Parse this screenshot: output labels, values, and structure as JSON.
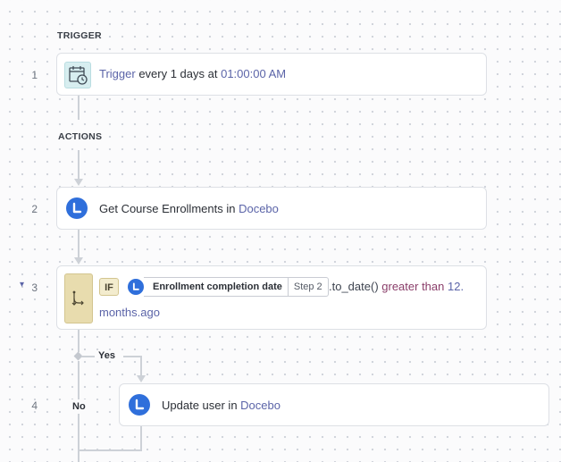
{
  "labels": {
    "trigger_section": "TRIGGER",
    "actions_section": "ACTIONS"
  },
  "steps": {
    "s1": {
      "number": "1",
      "keyword": "Trigger",
      "middle": " every 1 days at ",
      "time": "01:00:00 AM"
    },
    "s2": {
      "number": "2",
      "text": "Get Course Enrollments in ",
      "app": "Docebo"
    },
    "s3": {
      "number": "3",
      "collapse_glyph": "▾",
      "if_label": "IF",
      "pill_text": "Enrollment completion date",
      "pill_step": "Step 2",
      "expr_method": ".to_date()",
      "expr_op": " greater than ",
      "expr_value": "12.",
      "expr_line2": "months.ago"
    },
    "s4": {
      "number": "4",
      "text": "Update user in ",
      "app": "Docebo"
    }
  },
  "branches": {
    "yes": "Yes",
    "no": "No"
  },
  "colors": {
    "accent_link": "#5b64a8",
    "docebo_blue": "#2f6fdb",
    "if_block_bg": "#e8dcae",
    "calendar_bg": "#d7eef0",
    "operator_color": "#8a3e6a",
    "connector": "#cdd1d7"
  },
  "icons": {
    "trigger": "calendar-clock-icon",
    "app": "docebo-logo-icon",
    "if": "branch-icon",
    "collapse": "chevron-down-icon"
  }
}
